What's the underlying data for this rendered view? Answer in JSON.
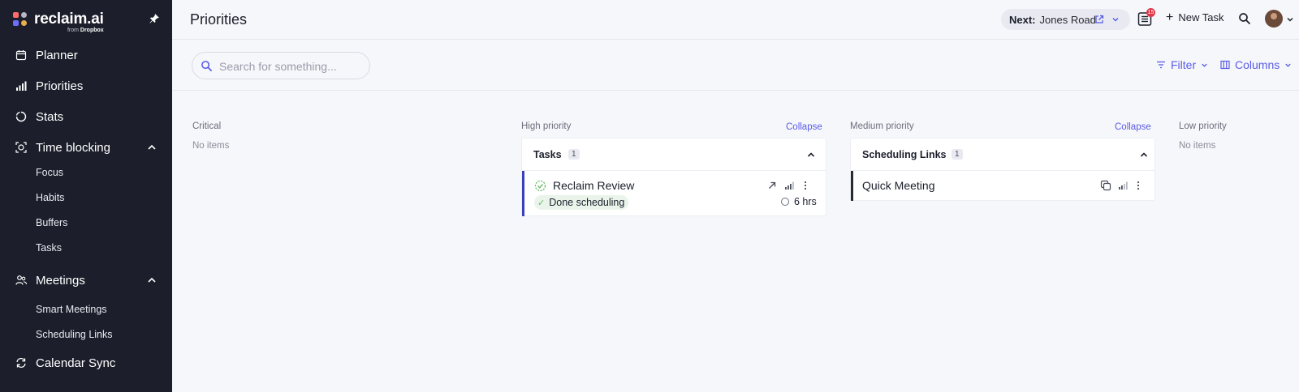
{
  "sidebar": {
    "logo_name": "reclaim.ai",
    "logo_sub_prefix": "from",
    "logo_sub_brand": "Dropbox",
    "items": [
      {
        "label": "Planner",
        "icon": "calendar-icon"
      },
      {
        "label": "Priorities",
        "icon": "bar-chart-icon"
      },
      {
        "label": "Stats",
        "icon": "stats-ring-icon"
      },
      {
        "label": "Time blocking",
        "icon": "time-block-icon",
        "expanded": true
      },
      {
        "label": "Focus"
      },
      {
        "label": "Habits"
      },
      {
        "label": "Buffers"
      },
      {
        "label": "Tasks"
      },
      {
        "label": "Meetings",
        "icon": "people-icon",
        "expanded": true
      },
      {
        "label": "Smart Meetings"
      },
      {
        "label": "Scheduling Links"
      },
      {
        "label": "Calendar Sync",
        "icon": "sync-icon"
      }
    ]
  },
  "header": {
    "title": "Priorities",
    "next_label": "Next:",
    "next_value": "Jones Road",
    "badge_count": "15",
    "new_task_label": "New Task"
  },
  "toolbar": {
    "search_placeholder": "Search for something...",
    "filter_label": "Filter",
    "columns_label": "Columns"
  },
  "columns": {
    "critical": {
      "title": "Critical",
      "empty": "No items"
    },
    "high": {
      "title": "High priority",
      "collapse": "Collapse",
      "group_title": "Tasks",
      "group_count": "1",
      "task_name": "Reclaim Review",
      "task_status": "Done scheduling",
      "task_hours": "6 hrs",
      "accent": "#3b3fb8"
    },
    "medium": {
      "title": "Medium priority",
      "collapse": "Collapse",
      "group_title": "Scheduling Links",
      "group_count": "1",
      "link_name": "Quick Meeting",
      "accent": "#2a2a33"
    },
    "low": {
      "title": "Low priority",
      "empty": "No items"
    }
  },
  "colors": {
    "sidebar_bg": "#1c1f2b",
    "accent": "#5a5ce8",
    "background": "#f6f7fa"
  }
}
